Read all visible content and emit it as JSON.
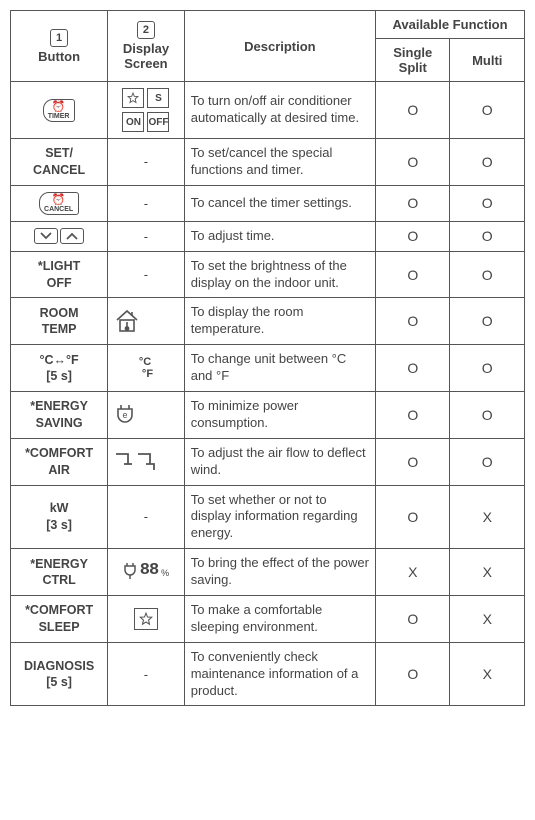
{
  "headers": {
    "button_num": "1",
    "button": "Button",
    "screen_num": "2",
    "screen": "Display Screen",
    "description": "Description",
    "available_function": "Available Function",
    "single_split": "Single Split",
    "multi": "Multi"
  },
  "rows": [
    {
      "button_type": "timer-icon",
      "button_text": "TIMER",
      "screen_type": "timer-screen",
      "description": "To turn on/off air conditioner automatically at desired time.",
      "single": "O",
      "multi": "O"
    },
    {
      "button_type": "text",
      "button_text": "SET/\nCANCEL",
      "screen_type": "dash",
      "description": "To set/cancel the special functions and timer.",
      "single": "O",
      "multi": "O"
    },
    {
      "button_type": "cancel-icon",
      "button_text": "CANCEL",
      "screen_type": "dash",
      "description": "To cancel the timer settings.",
      "single": "O",
      "multi": "O"
    },
    {
      "button_type": "arrows",
      "button_text": "",
      "screen_type": "dash",
      "description": "To adjust time.",
      "single": "O",
      "multi": "O"
    },
    {
      "button_type": "text",
      "button_text": "*LIGHT\nOFF",
      "screen_type": "dash",
      "description": "To set the brightness of the display on the indoor unit.",
      "single": "O",
      "multi": "O"
    },
    {
      "button_type": "text",
      "button_text": "ROOM\nTEMP",
      "screen_type": "house-icon",
      "description": "To display the room temperature.",
      "single": "O",
      "multi": "O"
    },
    {
      "button_type": "text",
      "button_text": "°C↔°F\n[5 s]",
      "screen_type": "cf-icon",
      "description": "To change unit between °C and °F",
      "single": "O",
      "multi": "O"
    },
    {
      "button_type": "text",
      "button_text": "*ENERGY\nSAVING",
      "screen_type": "plug-icon",
      "description": "To minimize power consumption.",
      "single": "O",
      "multi": "O"
    },
    {
      "button_type": "text",
      "button_text": "*COMFORT\nAIR",
      "screen_type": "air-icon",
      "description": "To adjust the air flow to deflect wind.",
      "single": "O",
      "multi": "O"
    },
    {
      "button_type": "text",
      "button_text": "kW\n[3 s]",
      "screen_type": "dash",
      "description": "To set whether or not to display information regarding energy.",
      "single": "O",
      "multi": "X"
    },
    {
      "button_type": "text",
      "button_text": "*ENERGY\nCTRL",
      "screen_type": "energy-ctrl-icon",
      "screen_text": "88",
      "description": "To bring the effect of the power saving.",
      "single": "X",
      "multi": "X"
    },
    {
      "button_type": "text",
      "button_text": "*COMFORT\nSLEEP",
      "screen_type": "star-icon",
      "description": "To make a comfortable sleeping environment.",
      "single": "O",
      "multi": "X"
    },
    {
      "button_type": "text",
      "button_text": "DIAGNOSIS\n[5 s]",
      "screen_type": "dash",
      "description": "To conveniently check maintenance information of a product.",
      "single": "O",
      "multi": "X"
    }
  ],
  "screen_labels": {
    "on": "ON",
    "off": "OFF",
    "s": "S",
    "pct": "%",
    "degC": "°C",
    "degF": "°F"
  }
}
